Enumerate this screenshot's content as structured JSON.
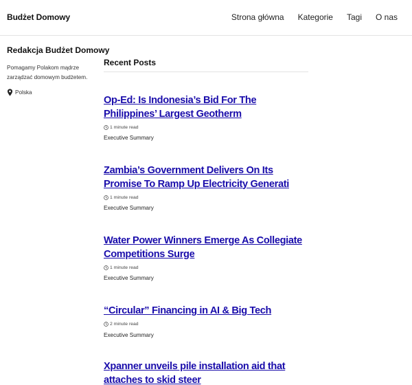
{
  "header": {
    "site_title": "Budżet Domowy",
    "nav": [
      {
        "label": "Strona główna"
      },
      {
        "label": "Kategorie"
      },
      {
        "label": "Tagi"
      },
      {
        "label": "O nas"
      }
    ]
  },
  "sidebar": {
    "author_name": "Redakcja Budżet Domowy",
    "bio": "Pomagamy Polakom mądrze zarządzać domowym budżetem.",
    "location": "Polska",
    "location_icon": "map-pin-icon"
  },
  "main": {
    "section_title": "Recent Posts",
    "posts": [
      {
        "title": "Op-Ed: Is Indonesia’s Bid For The Philippines’ Largest Geotherm",
        "read_time": "1 minute read",
        "category": "Executive Summary"
      },
      {
        "title": "Zambia’s Government Delivers On Its Promise To Ramp Up Electricity Generati",
        "read_time": "1 minute read",
        "category": "Executive Summary"
      },
      {
        "title": "Water Power Winners Emerge As Collegiate Competitions Surge",
        "read_time": "1 minute read",
        "category": "Executive Summary"
      },
      {
        "title": "“Circular” Financing in AI & Big Tech",
        "read_time": "2 minute read",
        "category": "Executive Summary"
      },
      {
        "title": "Xpanner unveils pile installation aid that attaches to skid steer",
        "read_time": "",
        "category": ""
      }
    ]
  },
  "colors": {
    "link": "#1a0dab",
    "text": "#222222",
    "divider": "#e3e3e3"
  }
}
